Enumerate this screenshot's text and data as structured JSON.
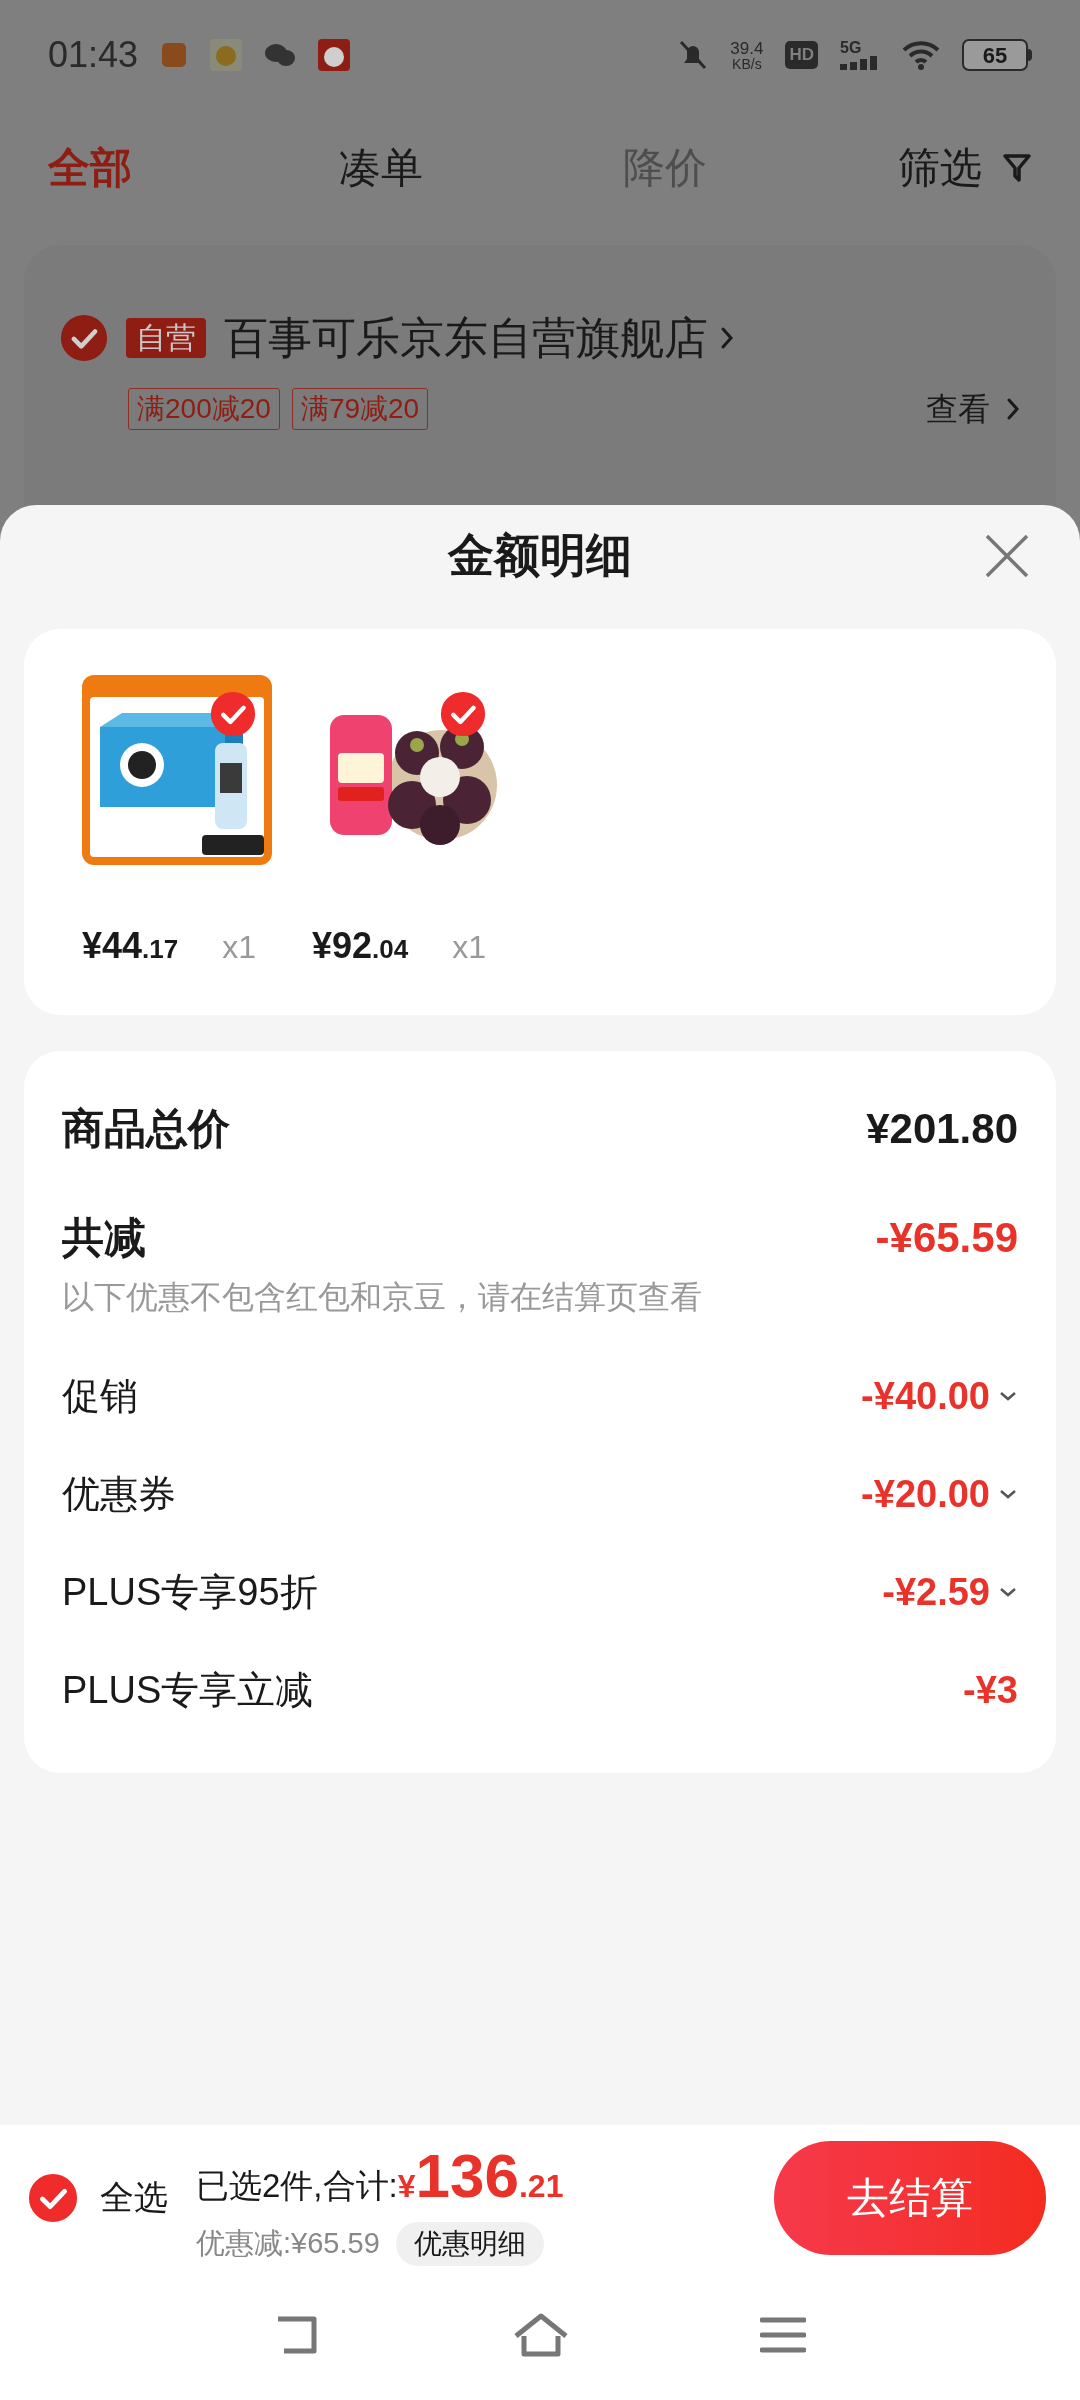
{
  "status_bar": {
    "time": "01:43",
    "net_speed": "39.4",
    "net_unit": "KB/s",
    "hd": "HD",
    "network": "5G",
    "battery": "65"
  },
  "tabs": [
    {
      "label": "全部",
      "selected": true
    },
    {
      "label": "凑单",
      "selected": false
    },
    {
      "label": "降价",
      "selected": false,
      "disabled": true
    }
  ],
  "filter": "筛选",
  "store": {
    "checked": true,
    "badge": "自营",
    "name": "百事可乐京东自营旗舰店",
    "promos": [
      "满200减20",
      "满79减20"
    ],
    "view": "查看"
  },
  "sheet": {
    "title": "金额明细",
    "items": [
      {
        "checked": true,
        "framed": true,
        "price_int": "¥44",
        "price_dec": ".17",
        "qty": "x1"
      },
      {
        "checked": true,
        "framed": false,
        "price_int": "¥92",
        "price_dec": ".04",
        "qty": "x1"
      }
    ],
    "total_label": "商品总价",
    "total_value": "¥201.80",
    "discount_label": "共减",
    "discount_value": "-¥65.59",
    "note": "以下优惠不包含红包和京豆，请在结算页查看",
    "lines": [
      {
        "label": "促销",
        "value": "-¥40.00",
        "expandable": true
      },
      {
        "label": "优惠券",
        "value": "-¥20.00",
        "expandable": true
      },
      {
        "label": "PLUS专享95折",
        "value": "-¥2.59",
        "expandable": true
      },
      {
        "label": "PLUS专享立减",
        "value": "-¥3",
        "expandable": false
      }
    ]
  },
  "bottom": {
    "select_all": {
      "label": "全选",
      "checked": true
    },
    "selected_text": "已选2件,合计:",
    "currency": "¥",
    "total_int": "136",
    "total_dec": ".21",
    "discount": "优惠减:¥65.59",
    "detail_button": "优惠明细",
    "checkout": "去结算"
  }
}
